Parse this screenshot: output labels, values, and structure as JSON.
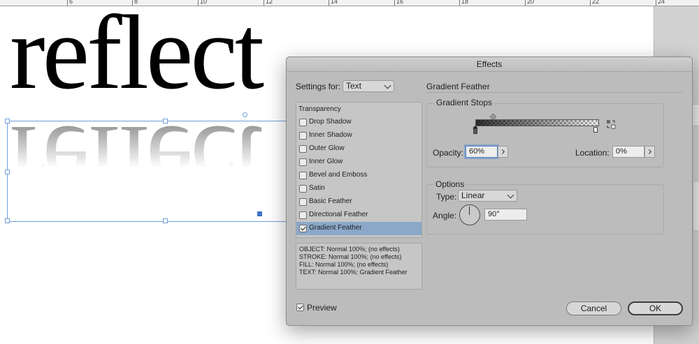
{
  "ruler": {
    "labels": [
      "6",
      "8",
      "10",
      "12",
      "14",
      "16",
      "18",
      "20",
      "22",
      "24"
    ]
  },
  "canvas": {
    "text": "reflect"
  },
  "dialog": {
    "title": "Effects",
    "settings_for_label": "Settings for:",
    "settings_for_value": "Text",
    "section_title": "Gradient Feather",
    "list_header": "Transparency",
    "effects": [
      {
        "label": "Drop Shadow",
        "checked": false
      },
      {
        "label": "Inner Shadow",
        "checked": false
      },
      {
        "label": "Outer Glow",
        "checked": false
      },
      {
        "label": "Inner Glow",
        "checked": false
      },
      {
        "label": "Bevel and Emboss",
        "checked": false
      },
      {
        "label": "Satin",
        "checked": false
      },
      {
        "label": "Basic Feather",
        "checked": false
      },
      {
        "label": "Directional Feather",
        "checked": false
      },
      {
        "label": "Gradient Feather",
        "checked": true
      }
    ],
    "summary": [
      "OBJECT: Normal 100%; (no effects)",
      "STROKE: Normal 100%; (no effects)",
      "FILL: Normal 100%; (no effects)",
      "TEXT: Normal 100%; Gradient Feather"
    ],
    "gradient_stops": {
      "title": "Gradient Stops",
      "opacity_label": "Opacity:",
      "opacity_value": "60%",
      "location_label": "Location:",
      "location_value": "0%"
    },
    "options": {
      "title": "Options",
      "type_label": "Type:",
      "type_value": "Linear",
      "angle_label": "Angle:",
      "angle_value": "90°",
      "angle_degrees": 90
    },
    "preview_label": "Preview",
    "preview_checked": true,
    "cancel_label": "Cancel",
    "ok_label": "OK"
  },
  "colors": {
    "selection": "#6f9ed8",
    "list_selected": "#8ba8c9",
    "dialog_bg": "#bcbcbc"
  }
}
